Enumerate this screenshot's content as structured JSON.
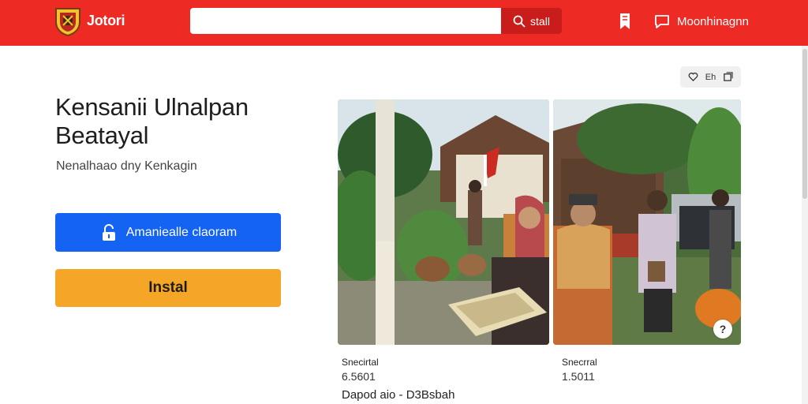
{
  "header": {
    "brand": "Jotori",
    "search": {
      "value": "",
      "placeholder": ""
    },
    "search_button_label": "stall",
    "message_label": "Moonhinagnn",
    "search_icon": "search-icon",
    "bookmark_icon": "bookmark-icon",
    "message_icon": "chat-bubble-icon",
    "logo_icon": "crest-logo-icon"
  },
  "main": {
    "title": "Kensanii Ulnalpan Beatayal",
    "subtitle": "Nenalhaao dny Kenkagin",
    "primary_button_label": "Amanieallе claoram",
    "primary_button_icon": "unlock-icon",
    "install_button_label": "Instal"
  },
  "gallery": {
    "chip_icon_1": "heart-icon",
    "chip_label": "Eh",
    "chip_icon_2": "copy-icon",
    "help_symbol": "?",
    "items": [
      {
        "label": "Snecirtal",
        "value": "6.5601"
      },
      {
        "label": "Snecrral",
        "value": "1.5011"
      }
    ],
    "footer_text": "Dapod aio - D3Bsbah"
  },
  "colors": {
    "header_bg": "#ee2a24",
    "search_button_bg": "#c81d1a",
    "primary_button_bg": "#1463f3",
    "install_button_bg": "#f6a626"
  }
}
